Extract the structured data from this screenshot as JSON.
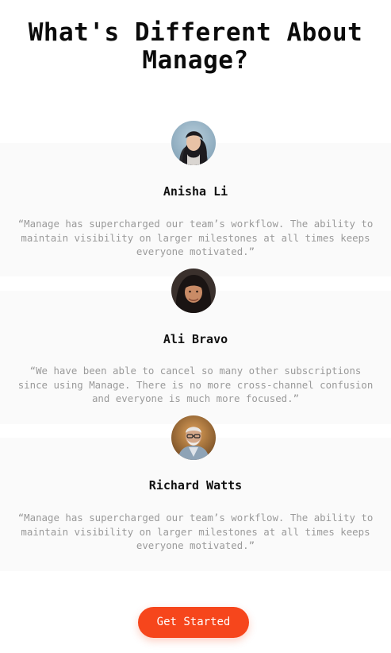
{
  "heading": {
    "line1": "What's Different About",
    "line2": "Manage?"
  },
  "testimonials": [
    {
      "name": "Anisha Li",
      "quote": "“Manage has supercharged our team’s workflow. The ability to maintain visibility on larger milestones at all times keeps everyone motivated.”",
      "avatar_icon": "avatar-anisha"
    },
    {
      "name": "Ali Bravo",
      "quote": "“We have been able to cancel so many other subscriptions since using Manage. There is no more cross-channel confusion and everyone is much more focused.”",
      "avatar_icon": "avatar-ali"
    },
    {
      "name": "Richard Watts",
      "quote": "“Manage has supercharged our team’s workflow. The ability to maintain visibility on larger milestones at all times keeps everyone motivated.”",
      "avatar_icon": "avatar-richard"
    }
  ],
  "cta": {
    "label": "Get Started"
  },
  "colors": {
    "accent": "#f6461c",
    "card_background": "#fafafa",
    "heading_text": "#0b0b0b",
    "quote_text": "#9a9a9a"
  }
}
